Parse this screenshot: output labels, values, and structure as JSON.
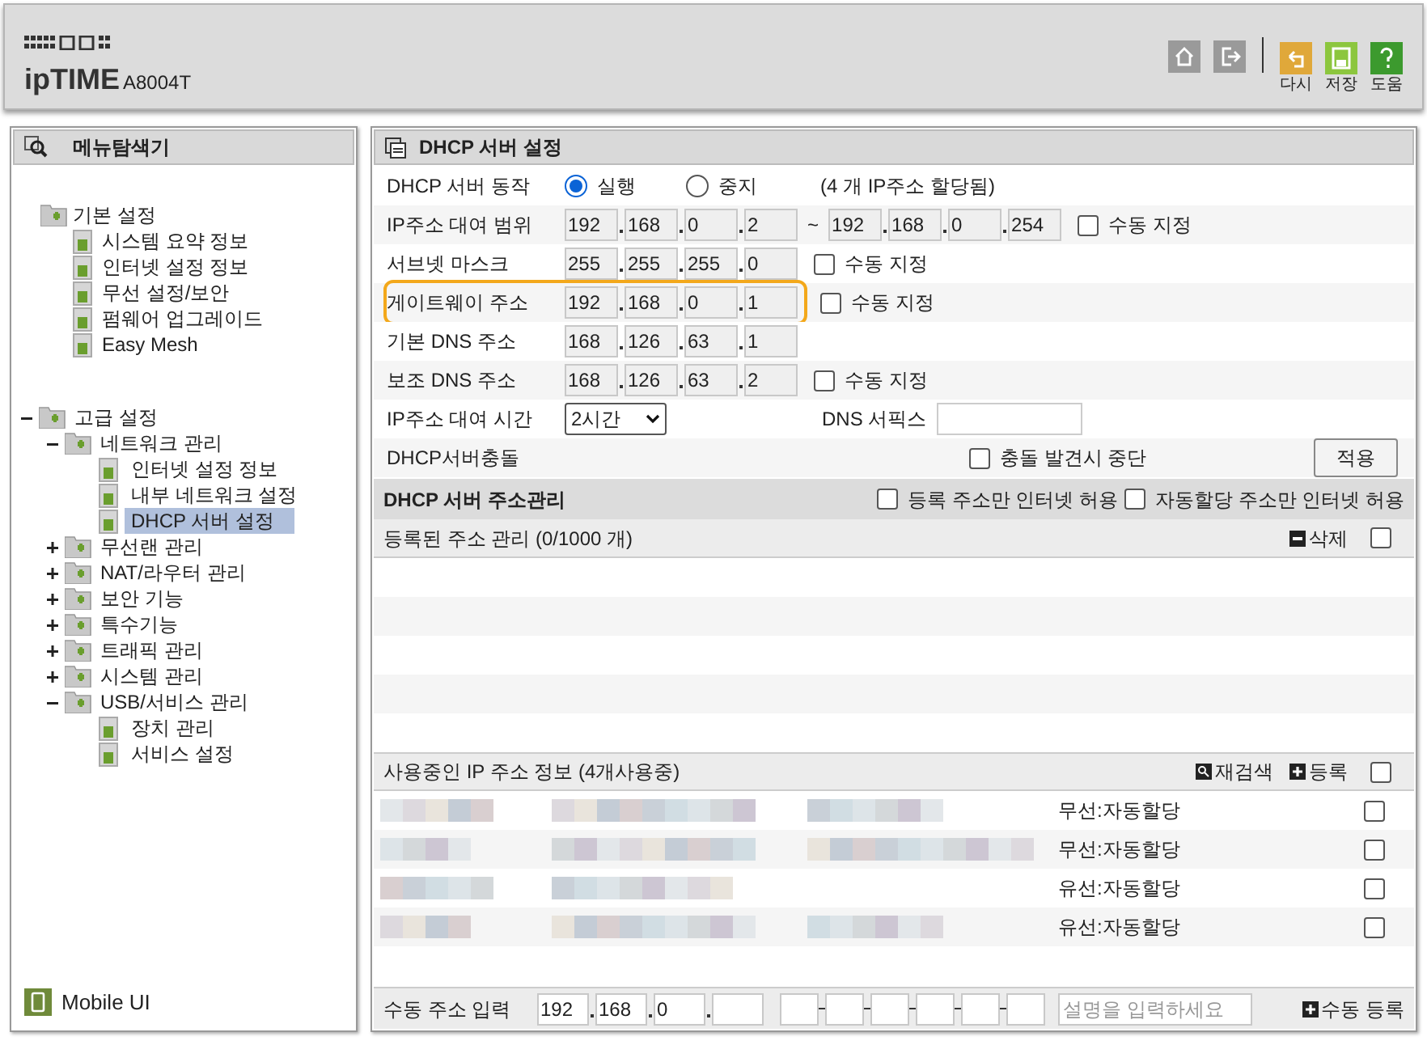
{
  "header": {
    "logo": "ipTIME",
    "model": "A8004T",
    "tools": [
      {
        "label": "다시",
        "kind": "undo"
      },
      {
        "label": "저장",
        "kind": "save"
      },
      {
        "label": "도움",
        "kind": "help"
      }
    ]
  },
  "sidebar": {
    "title": "메뉴탐색기",
    "tree": [
      {
        "label": "기본 설정",
        "children": [
          {
            "label": "시스템 요약 정보"
          },
          {
            "label": "인터넷 설정 정보"
          },
          {
            "label": "무선 설정/보안"
          },
          {
            "label": "펌웨어 업그레이드"
          },
          {
            "label": "Easy Mesh"
          }
        ]
      },
      {
        "label": "고급 설정",
        "expanded": true,
        "children": [
          {
            "label": "네트워크 관리",
            "expanded": true,
            "children": [
              {
                "label": "인터넷 설정 정보",
                "selected": false
              },
              {
                "label": "내부 네트워크 설정",
                "selected": false
              },
              {
                "label": "DHCP 서버 설정",
                "selected": true
              }
            ]
          },
          {
            "label": "무선랜 관리",
            "expanded": false
          },
          {
            "label": "NAT/라우터 관리",
            "expanded": false
          },
          {
            "label": "보안 기능",
            "expanded": false
          },
          {
            "label": "특수기능",
            "expanded": false
          },
          {
            "label": "트래픽 관리",
            "expanded": false
          },
          {
            "label": "시스템 관리",
            "expanded": false
          },
          {
            "label": "USB/서비스 관리",
            "expanded": true,
            "children": [
              {
                "label": "장치 관리",
                "selected": false
              },
              {
                "label": "서비스 설정",
                "selected": false
              }
            ]
          }
        ]
      }
    ],
    "mobile": "Mobile UI"
  },
  "main": {
    "title": "DHCP 서버 설정",
    "rows": [
      {
        "kind": "radio",
        "label": "DHCP 서버 동작",
        "options": [
          {
            "label": "실행",
            "selected": true
          },
          {
            "label": "중지",
            "selected": false
          }
        ],
        "note": "(4 개 IP주소 할당됨)"
      },
      {
        "kind": "range",
        "label": "IP주소 대여 범위",
        "start": [
          "192",
          "168",
          "0",
          "2"
        ],
        "separator": "~",
        "end": [
          "192",
          "168",
          "0",
          "254"
        ],
        "manual": {
          "label": "수동 지정",
          "checked": false
        }
      },
      {
        "kind": "ip",
        "label": "서브넷 마스크",
        "octets": [
          "255",
          "255",
          "255",
          "0"
        ],
        "manual": {
          "label": "수동 지정",
          "checked": false
        }
      },
      {
        "kind": "ip",
        "label": "게이트웨이 주소",
        "octets": [
          "192",
          "168",
          "0",
          "1"
        ],
        "manual": {
          "label": "수동 지정",
          "checked": false
        },
        "highlighted": true
      },
      {
        "kind": "ip",
        "label": "기본 DNS 주소",
        "octets": [
          "168",
          "126",
          "63",
          "1"
        ]
      },
      {
        "kind": "ip",
        "label": "보조 DNS 주소",
        "octets": [
          "168",
          "126",
          "63",
          "2"
        ],
        "manual": {
          "label": "수동 지정",
          "checked": false
        }
      },
      {
        "kind": "lease",
        "label": "IP주소 대여 시간",
        "value": "2시간",
        "suffix_label": "DNS 서픽스"
      },
      {
        "kind": "conflict",
        "label": "DHCP서버충돌",
        "option": {
          "label": "충돌 발견시 중단",
          "checked": false
        },
        "button": "적용"
      }
    ],
    "address_management": {
      "title": "DHCP 서버 주소관리",
      "options": [
        {
          "label": "등록 주소만 인터넷 허용",
          "checked": false
        },
        {
          "label": "자동할당 주소만 인터넷 허용",
          "checked": false
        }
      ]
    },
    "registered": {
      "title": "등록된 주소 관리 (0/1000 개)",
      "action": "삭제",
      "checked": false
    },
    "in_use": {
      "title": "사용중인 IP 주소 정보 (4개사용중)",
      "actions": [
        {
          "label": "재검색",
          "kind": "search"
        },
        {
          "label": "등록",
          "kind": "add"
        }
      ],
      "checked": false,
      "rows": [
        {
          "type": "무선:자동할당",
          "checked": false
        },
        {
          "type": "무선:자동할당",
          "checked": false
        },
        {
          "type": "유선:자동할당",
          "checked": false
        },
        {
          "type": "유선:자동할당",
          "checked": false
        }
      ]
    },
    "manual_entry": {
      "label": "수동 주소 입력",
      "octets": [
        "192",
        "168",
        "0"
      ],
      "description_placeholder": "설명을 입력하세요",
      "button": "수동 등록"
    }
  }
}
